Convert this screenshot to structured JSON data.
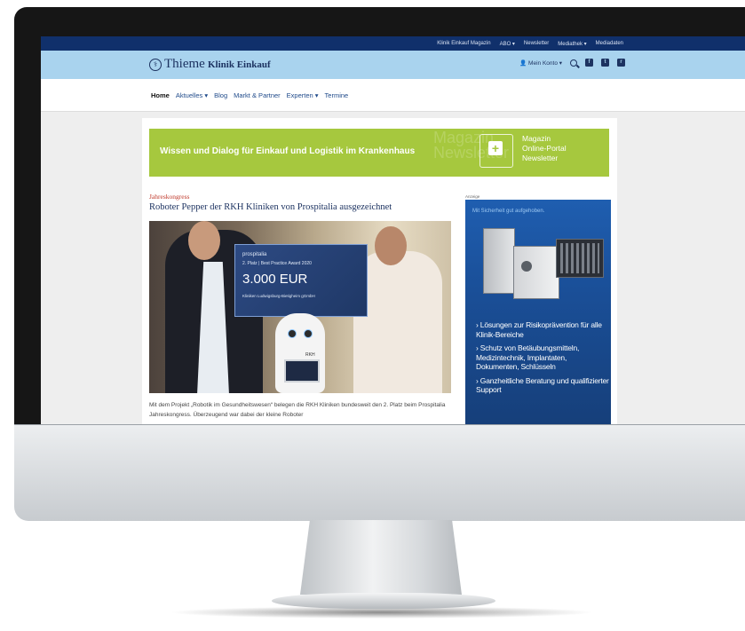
{
  "topbar": {
    "links": [
      "Klinik Einkauf Magazin",
      "ABO ▾",
      "Newsletter",
      "Mediathek ▾",
      "Mediadaten"
    ]
  },
  "header": {
    "logo_text": "Thieme",
    "site_name": "Klinik Einkauf",
    "account_label": "Mein Konto ▾",
    "social_icons": [
      "facebook-icon",
      "twitter-icon",
      "rss-icon"
    ]
  },
  "nav": {
    "items": [
      "Home",
      "Aktuelles ▾",
      "Blog",
      "Markt & Partner",
      "Experten ▾",
      "Termine"
    ]
  },
  "banner": {
    "tagline": "Wissen und Dialog für Einkauf und Logistik im Krankenhaus",
    "list": [
      "Magazin",
      "Online-Portal",
      "Newsletter"
    ],
    "bg_text": [
      "Magazin",
      "Newsletter"
    ],
    "color": "#a6c83e"
  },
  "article": {
    "kicker": "Jahreskongress",
    "headline": "Roboter Pepper der RKH Kliniken von Prospitalia ausgezeichnet",
    "photo": {
      "cheque_brand": "prospitalia",
      "cheque_award": "2. Platz | Best Practice Award 2020",
      "cheque_amount": "3.000 EUR",
      "cheque_recipient": "Kliniken Ludwigsburg-Bietigheim gGmbH",
      "robot_tag": "RKH"
    },
    "teaser": "Mit dem Projekt „Robotik im Gesundheitswesen“ belegen die RKH Kliniken bundesweit den 2. Platz beim Prospitalia Jahreskongress. Überzeugend war dabei der kleine Roboter"
  },
  "ad": {
    "label": "Anzeige",
    "slogan": "Mit Sicherheit gut aufgehoben.",
    "bullets": [
      "› Lösungen zur Risikoprävention für alle Klinik-Bereiche",
      "› Schutz von Betäubungsmitteln, Medizintechnik, Implantaten, Dokumenten, Schlüsseln",
      "› Ganzheitliche Beratung und qualifizierter Support"
    ]
  },
  "colors": {
    "topbar": "#10306b",
    "brandbar": "#a9d3ee",
    "accent_red": "#c0392b",
    "ad_blue": "#1a4f98"
  }
}
